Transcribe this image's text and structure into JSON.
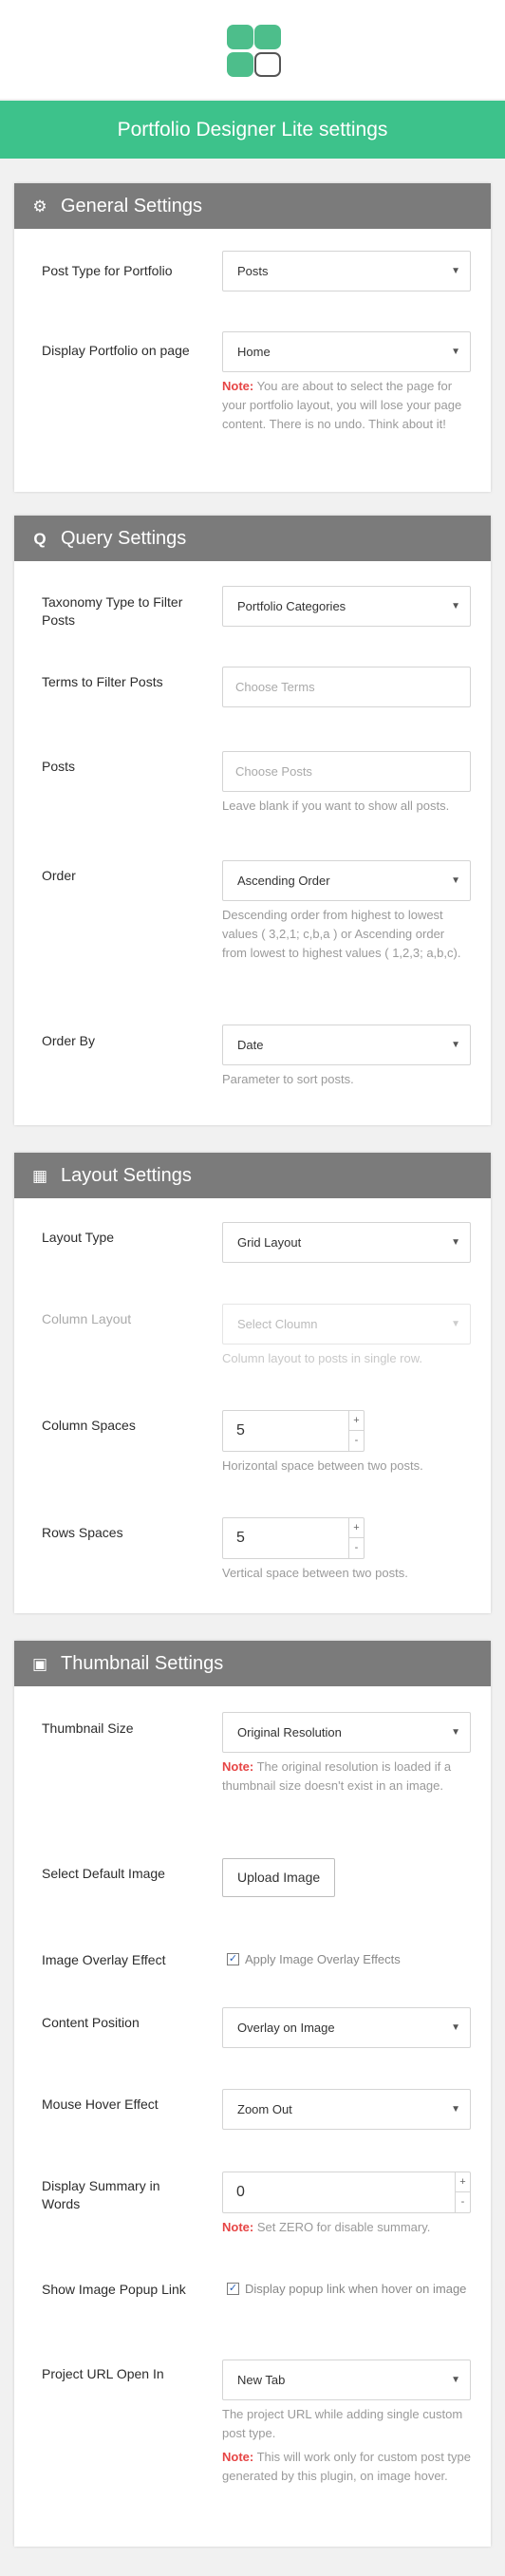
{
  "header": {
    "title": "Portfolio Designer Lite settings"
  },
  "general": {
    "title": "General Settings",
    "post_type": {
      "label": "Post Type for Portfolio",
      "value": "Posts"
    },
    "display_page": {
      "label": "Display Portfolio on page",
      "value": "Home",
      "note_label": "Note:",
      "note_text": " You are about to select the page for your portfolio layout, you will lose your page content. There is no undo. Think about it!"
    }
  },
  "query": {
    "title": "Query Settings",
    "taxonomy": {
      "label": "Taxonomy Type to Filter Posts",
      "value": "Portfolio Categories"
    },
    "terms": {
      "label": "Terms to Filter Posts",
      "placeholder": "Choose Terms"
    },
    "posts": {
      "label": "Posts",
      "placeholder": "Choose Posts",
      "help": "Leave blank if you want to show all posts."
    },
    "order": {
      "label": "Order",
      "value": "Ascending Order",
      "help": "Descending order from highest to lowest values ( 3,2,1; c,b,a ) or Ascending order from lowest to highest values ( 1,2,3; a,b,c)."
    },
    "order_by": {
      "label": "Order By",
      "value": "Date",
      "help": "Parameter to sort posts."
    }
  },
  "layout": {
    "title": "Layout Settings",
    "layout_type": {
      "label": "Layout Type",
      "value": "Grid Layout"
    },
    "column_layout": {
      "label": "Column Layout",
      "value": "Select Cloumn",
      "help": "Column layout to posts in single row."
    },
    "column_spaces": {
      "label": "Column Spaces",
      "value": "5",
      "help": "Horizontal space between two posts."
    },
    "rows_spaces": {
      "label": "Rows Spaces",
      "value": "5",
      "help": "Vertical space between two posts."
    }
  },
  "thumbnail": {
    "title": "Thumbnail Settings",
    "size": {
      "label": "Thumbnail Size",
      "value": "Original Resolution",
      "note_label": "Note:",
      "note_text": " The original resolution is loaded if a thumbnail size doesn't exist in an image."
    },
    "default_image": {
      "label": "Select Default Image",
      "button": "Upload Image"
    },
    "overlay": {
      "label": "Image Overlay Effect",
      "checkbox_label": "Apply Image Overlay Effects",
      "checked": true
    },
    "content_position": {
      "label": "Content Position",
      "value": "Overlay on Image"
    },
    "hover_effect": {
      "label": "Mouse Hover Effect",
      "value": "Zoom Out"
    },
    "summary_words": {
      "label": "Display Summary in Words",
      "value": "0",
      "note_label": "Note:",
      "note_text": " Set ZERO for disable summary."
    },
    "popup_link": {
      "label": "Show Image Popup Link",
      "checkbox_label": "Display popup link when hover on image",
      "checked": true
    },
    "url_open": {
      "label": "Project URL Open In",
      "value": "New Tab",
      "help": "The project URL while adding single custom post type.",
      "note_label": "Note:",
      "note_text": " This will work only for custom post type generated by this plugin, on image hover."
    }
  },
  "icons": {
    "caret": "▼",
    "spin_up": "+",
    "spin_down": "-",
    "check": "✓",
    "general": "gear-icon",
    "query": "search-icon",
    "layout": "grid-icon",
    "thumbnail": "image-icon"
  },
  "colors": {
    "accent": "#3dc28b",
    "panel_header": "#7b7b7b",
    "note": "#e64545"
  }
}
